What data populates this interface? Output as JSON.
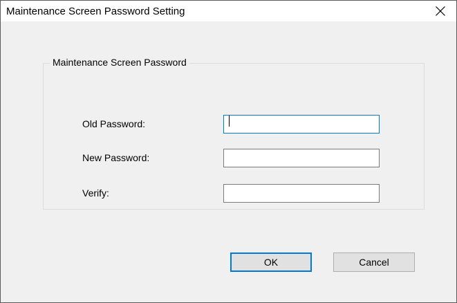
{
  "window": {
    "title": "Maintenance Screen Password Setting"
  },
  "icons": {
    "close": "close-icon"
  },
  "group": {
    "title": "Maintenance Screen Password"
  },
  "fields": {
    "old_password": {
      "label": "Old Password:",
      "value": ""
    },
    "new_password": {
      "label": "New Password:",
      "value": ""
    },
    "verify": {
      "label": "Verify:",
      "value": ""
    }
  },
  "buttons": {
    "ok": "OK",
    "cancel": "Cancel"
  },
  "colors": {
    "focus_accent": "#0078d7",
    "dialog_background": "#f0f0f0"
  }
}
